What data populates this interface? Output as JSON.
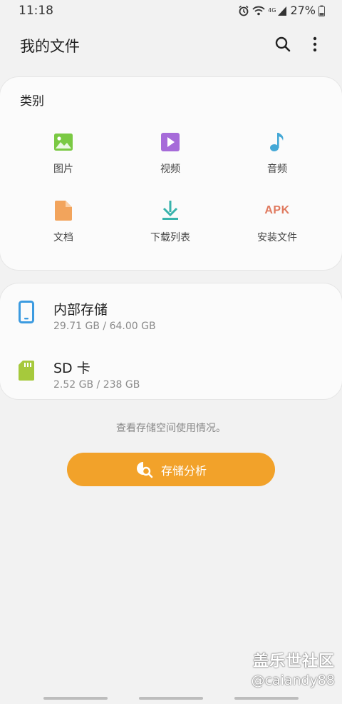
{
  "status": {
    "time": "11:18",
    "network": "4G",
    "battery": "27%"
  },
  "header": {
    "title": "我的文件"
  },
  "categories": {
    "title": "类别",
    "items": [
      {
        "label": "图片",
        "icon": "image-icon",
        "color": "#7ac943"
      },
      {
        "label": "视频",
        "icon": "video-icon",
        "color": "#a66bd9"
      },
      {
        "label": "音频",
        "icon": "music-note-icon",
        "color": "#44a8d6"
      },
      {
        "label": "文档",
        "icon": "document-icon",
        "color": "#f2a45c"
      },
      {
        "label": "下载列表",
        "icon": "download-icon",
        "color": "#38b3ac"
      },
      {
        "label": "安装文件",
        "icon": "apk-icon",
        "color": "#e07a5f",
        "icon_text": "APK"
      }
    ]
  },
  "storage": [
    {
      "name": "内部存储",
      "size": "29.71 GB / 64.00 GB",
      "icon": "phone-icon",
      "color": "#3c9be0"
    },
    {
      "name": "SD 卡",
      "size": "2.52 GB / 238 GB",
      "icon": "sd-card-icon",
      "color": "#a6c93c"
    }
  ],
  "hint": "查看存储空间使用情况。",
  "analyze_button": {
    "label": "存储分析",
    "color": "#f2a22a"
  },
  "watermark": {
    "line1": "盖乐世社区",
    "line2": "@caiandy88"
  }
}
